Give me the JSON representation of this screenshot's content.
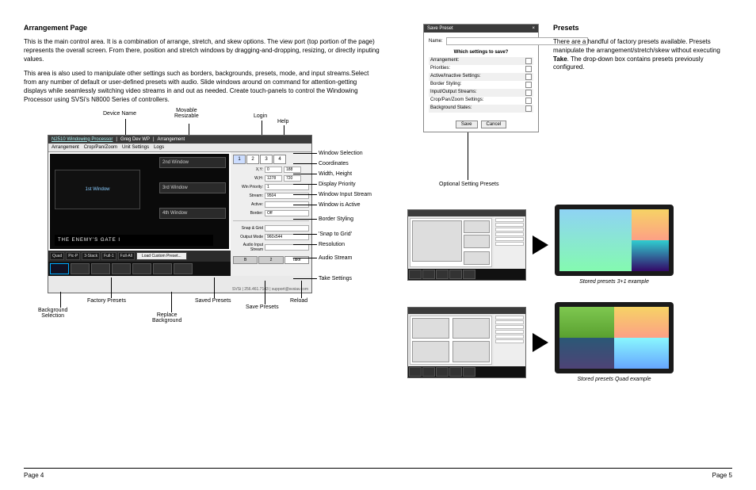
{
  "left": {
    "heading": "Arrangement Page",
    "p1": "This is the main control area. It is a combination of arrange, stretch, and skew options. The view port (top portion of the page) represents the overall screen. From there, position and stretch windows by dragging-and-dropping, resizing, or directly inputing values.",
    "p2": "This area is also used to manipulate other settings such as borders, backgrounds, presets, mode, and input streams.Select from any number of default or user-defined presets with audio. Slide windows around on command for attention-getting displays while seamlessly switching video streams in and out as needed. Create touch-panels to control the Windowing Processor using SVSi's N8000 Series of controllers."
  },
  "callouts_top": {
    "device_name": "Device Name",
    "movable": "Movable\nResizable",
    "login": "Login",
    "help": "Help"
  },
  "callouts_right": {
    "c1": "Window Selection",
    "c2": "Coordinates",
    "c3": "Width, Height",
    "c4": "Display Priority",
    "c5": "Window Input Stream",
    "c6": "Window is Active",
    "c7": "Border Styling",
    "c8": "'Snap to Grid'",
    "c9": "Resolution",
    "c10": "Audio Stream",
    "c11": "Take Settings"
  },
  "callouts_bottom": {
    "bg_sel": "Background\nSelection",
    "factory": "Factory Presets",
    "replace": "Replace\nBackground",
    "saved": "Saved Presets",
    "savep": "Save Presets",
    "reload": "Reload"
  },
  "ui": {
    "title_prod": "N2510 Windowing Processor",
    "title_dev": "Greg Dev WP",
    "title_page": "Arrangement",
    "tabs": [
      "Arrangement",
      "Crop/Pan/Zoom",
      "Unit Settings",
      "Logs"
    ],
    "win1": "1st Window",
    "win2": "2nd Window",
    "win3": "3rd Window",
    "win4": "4th Window",
    "gate": "THE ENEMY'S GATE I",
    "bar": [
      "Quad",
      "Pic-P",
      "3-Stack",
      "Full-1",
      "Full-All"
    ],
    "load": "Load Custom Preset...",
    "winsel": [
      "1",
      "2",
      "3",
      "4"
    ],
    "xy_lbl": "X,Y:",
    "xy_x": "0",
    "xy_y": "188",
    "wh_lbl": "W,H:",
    "wh_w": "1278",
    "wh_h": "720",
    "prio_lbl": "Win Priority:",
    "prio_v": "1",
    "stream_lbl": "Stream:",
    "stream_v": "9504",
    "active_lbl": "Active:",
    "border_lbl": "Border:",
    "border_v": "Off",
    "snap_lbl": "Snap & Grid",
    "out_lbl": "Output Mode",
    "out_v": "960x544",
    "audio_lbl": "Audio Input\nStream",
    "tabs2": [
      "B",
      "2",
      "Take"
    ],
    "footer": "SVSi | 256.461.7143 | support@svsiav.com"
  },
  "right": {
    "heading": "Presets",
    "p": "There are a handful of factory presets available. Presets manipulate the arrangement/stretch/skew without executing Take. The drop-down box contains presets previously configured.",
    "take_bold": "Take"
  },
  "dialog": {
    "title": "Save Preset",
    "name_lbl": "Name:",
    "q": "Which settings to save?",
    "opts": [
      "Arrangement:",
      "Priorities:",
      "Active/Inactive Settings:",
      "Border Styling:",
      "Input/Output Streams:",
      "Crop/Pan/Zoom Settings:",
      "Background States:"
    ],
    "save": "Save",
    "cancel": "Cancel",
    "callout": "Optional Setting Presets"
  },
  "ex": {
    "cap1": "Stored presets 3+1 example",
    "cap2": "Stored presets Quad example"
  },
  "footer": {
    "l": "Page 4",
    "r": "Page 5"
  }
}
